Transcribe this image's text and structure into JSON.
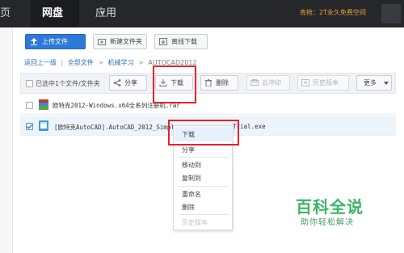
{
  "nav": {
    "items": [
      {
        "label": "主页",
        "visible": "页"
      },
      {
        "label": "网盘",
        "active": true
      },
      {
        "label": "应用"
      }
    ],
    "promo": "肯抢：2T永久免费空间"
  },
  "toolbar": {
    "upload": "上传文件",
    "new_folder": "新建文件夹",
    "offline_download": "离线下载"
  },
  "breadcrumb": {
    "back": "返回上一级",
    "separator": "|",
    "all_files": "全部文件",
    "folder1": "机械学习",
    "folder2": "AUTOCAD2012"
  },
  "list_toolbar": {
    "selection": "已选中1个文件/文件夹",
    "share": "分享",
    "download": "下载",
    "delete": "删除",
    "cloud_push": "云冲印",
    "history": "历史版本",
    "more": "更多"
  },
  "files": [
    {
      "name_left": "欧特克2012-Windows.x64全系列注册机.rar",
      "name_right": "",
      "checked": false
    },
    {
      "name_left": "[欧特克AutoCAD].AutoCAD_2012_Simpl",
      "name_right": "Trial.exe",
      "checked": true
    }
  ],
  "context_menu": {
    "download": "下载",
    "share": "分享",
    "move": "移动到",
    "copy": "复制到",
    "rename": "重命名",
    "delete": "删除",
    "history": "历史版本"
  },
  "watermark": {
    "title": "百科全说",
    "subtitle": "助你轻松解决"
  },
  "colors": {
    "nav_bg": "#26272b",
    "primary": "#2e79d8",
    "highlight": "#e8202a",
    "watermark": "#3db468"
  }
}
